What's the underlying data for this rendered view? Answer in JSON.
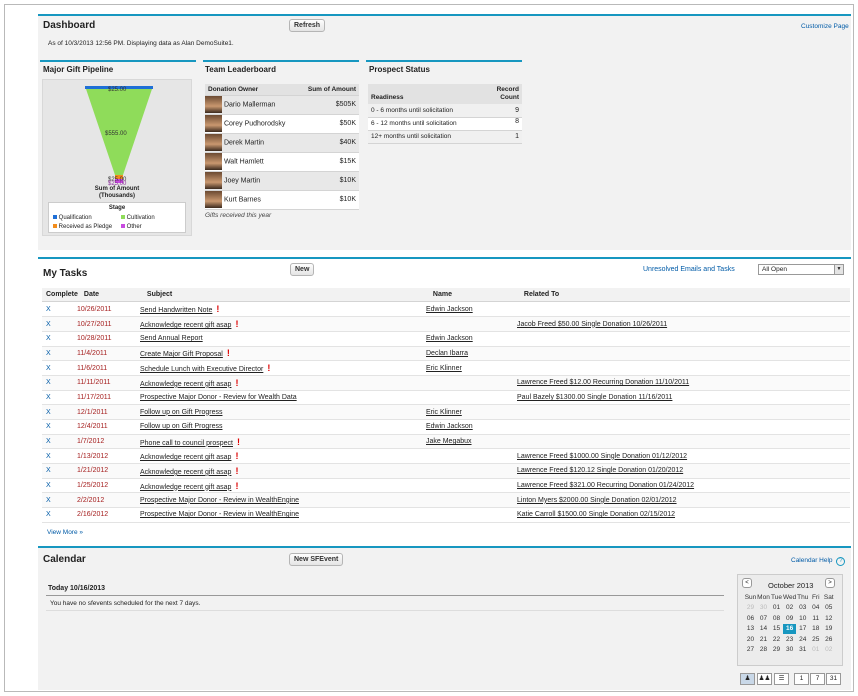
{
  "dashboard": {
    "title": "Dashboard",
    "refresh_label": "Refresh",
    "customize_label": "Customize Page",
    "asof": "As of 10/3/2013 12:56 PM. Displaying data as Alan DemoSuite1.",
    "pipeline": {
      "title": "Major Gift Pipeline",
      "values": [
        "$25.00",
        "$555.00",
        "$25.00",
        "$25.00"
      ],
      "axis_label": "Sum of Amount",
      "axis_unit": "(Thousands)",
      "legend_title": "Stage",
      "legend": [
        {
          "label": "Qualification",
          "color": "#1f6fd6"
        },
        {
          "label": "Cultivation",
          "color": "#8fdc5a"
        },
        {
          "label": "Received as Pledge",
          "color": "#f28c1b"
        },
        {
          "label": "Other",
          "color": "#c84be0"
        }
      ]
    },
    "leaderboard": {
      "title": "Team Leaderboard",
      "col_owner": "Donation Owner",
      "col_amount": "Sum of Amount",
      "rows": [
        {
          "name": "Dario Mallerman",
          "amount": "$505K"
        },
        {
          "name": "Corey Pudhorodsky",
          "amount": "$50K"
        },
        {
          "name": "Derek Martin",
          "amount": "$40K"
        },
        {
          "name": "Walt Hamlett",
          "amount": "$15K"
        },
        {
          "name": "Joey Martin",
          "amount": "$10K"
        },
        {
          "name": "Kurt Barnes",
          "amount": "$10K"
        }
      ],
      "footer": "Gifts received this year"
    },
    "prospect": {
      "title": "Prospect Status",
      "col_readiness": "Readiness",
      "col_count_1": "Record",
      "col_count_2": "Count",
      "rows": [
        {
          "label": "0 - 6 months until solicitation",
          "count": "9"
        },
        {
          "label": "6 - 12 months until solicitation",
          "count": "8"
        },
        {
          "label": "12+ months until solicitation",
          "count": "1"
        }
      ]
    }
  },
  "tasks": {
    "title": "My Tasks",
    "new_label": "New",
    "unresolved_label": "Unresolved Emails and Tasks",
    "filter_value": "All Open",
    "headers": {
      "complete": "Complete",
      "date": "Date",
      "subject": "Subject",
      "name": "Name",
      "related": "Related To"
    },
    "rows": [
      {
        "x": "X",
        "date": "10/26/2011",
        "subject": "Send Handwritten Note",
        "flag": "!",
        "name": "Edwin Jackson",
        "related": ""
      },
      {
        "x": "X",
        "date": "10/27/2011",
        "subject": "Acknowledge recent gift asap",
        "flag": "!",
        "name": "",
        "related": "Jacob Freed $50.00 Single Donation 10/26/2011"
      },
      {
        "x": "X",
        "date": "10/28/2011",
        "subject": "Send Annual Report",
        "flag": "",
        "name": "Edwin Jackson",
        "related": ""
      },
      {
        "x": "X",
        "date": "11/4/2011",
        "subject": "Create Major Gift Proposal",
        "flag": "!",
        "name": "Declan Ibarra",
        "related": ""
      },
      {
        "x": "X",
        "date": "11/6/2011",
        "subject": "Schedule Lunch with Executive Director",
        "flag": "!",
        "name": "Eric Klinner",
        "related": ""
      },
      {
        "x": "X",
        "date": "11/11/2011",
        "subject": "Acknowledge recent gift asap",
        "flag": "!",
        "name": "",
        "related": "Lawrence Freed $12.00 Recurring Donation 11/10/2011"
      },
      {
        "x": "X",
        "date": "11/17/2011",
        "subject": "Prospective Major Donor - Review for Wealth Data",
        "flag": "",
        "name": "",
        "related": "Paul Bazely $1300.00 Single Donation 11/16/2011"
      },
      {
        "x": "X",
        "date": "12/1/2011",
        "subject": "Follow up on Gift Progress",
        "flag": "",
        "name": "Eric Klinner",
        "related": ""
      },
      {
        "x": "X",
        "date": "12/4/2011",
        "subject": "Follow up on Gift Progress",
        "flag": "",
        "name": "Edwin Jackson",
        "related": ""
      },
      {
        "x": "X",
        "date": "1/7/2012",
        "subject": "Phone call to council prospect",
        "flag": "!",
        "name": "Jake Megabux",
        "related": ""
      },
      {
        "x": "X",
        "date": "1/13/2012",
        "subject": "Acknowledge recent gift asap",
        "flag": "!",
        "name": "",
        "related": "Lawrence Freed $1000.00 Single Donation 01/12/2012"
      },
      {
        "x": "X",
        "date": "1/21/2012",
        "subject": "Acknowledge recent gift asap",
        "flag": "!",
        "name": "",
        "related": "Lawrence Freed $120.12 Single Donation 01/20/2012"
      },
      {
        "x": "X",
        "date": "1/25/2012",
        "subject": "Acknowledge recent gift asap",
        "flag": "!",
        "name": "",
        "related": "Lawrence Freed $321.00 Recurring Donation 01/24/2012"
      },
      {
        "x": "X",
        "date": "2/2/2012",
        "subject": "Prospective Major Donor - Review in WealthEngine",
        "flag": "",
        "name": "",
        "related": "Linton Myers $2000.00 Single Donation 02/01/2012"
      },
      {
        "x": "X",
        "date": "2/16/2012",
        "subject": "Prospective Major Donor - Review in WealthEngine",
        "flag": "",
        "name": "",
        "related": "Katie Carroll $1500.00 Single Donation 02/15/2012"
      }
    ],
    "view_more": "View More »"
  },
  "calendar": {
    "title": "Calendar",
    "new_event_label": "New SFEvent",
    "help_label": "Calendar Help",
    "help_icon": "?",
    "today_label": "Today 10/16/2013",
    "no_events": "You have no sfevents scheduled for the next 7 days.",
    "month_label": "October 2013",
    "prev": "<",
    "next": ">",
    "weekdays": [
      "Sun",
      "Mon",
      "Tue",
      "Wed",
      "Thu",
      "Fri",
      "Sat"
    ],
    "weeks": [
      [
        "29",
        "30",
        "01",
        "02",
        "03",
        "04",
        "05"
      ],
      [
        "06",
        "07",
        "08",
        "09",
        "10",
        "11",
        "12"
      ],
      [
        "13",
        "14",
        "15",
        "16",
        "17",
        "18",
        "19"
      ],
      [
        "20",
        "21",
        "22",
        "23",
        "24",
        "25",
        "26"
      ],
      [
        "27",
        "28",
        "29",
        "30",
        "31",
        "01",
        "02"
      ]
    ],
    "today_day": "16",
    "view_day_label": "1",
    "view_week_label": "7",
    "view_month_label": "31"
  }
}
